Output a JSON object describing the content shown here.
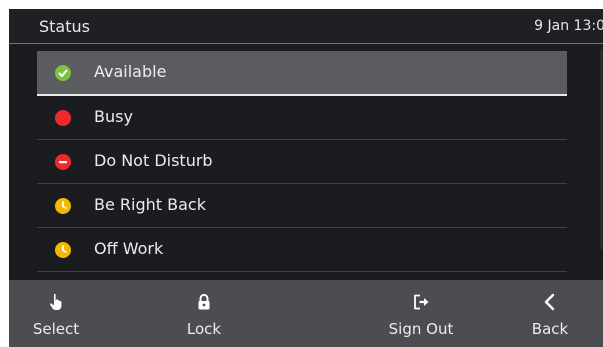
{
  "header": {
    "title": "Status",
    "time": "9 Jan 13:0"
  },
  "statuses": [
    {
      "label": "Available",
      "icon": "available-check-icon",
      "color": "#7cc242",
      "selected": true
    },
    {
      "label": "Busy",
      "icon": "busy-dot-icon",
      "color": "#f0282d",
      "selected": false
    },
    {
      "label": "Do Not Disturb",
      "icon": "do-not-disturb-icon",
      "color": "#f0282d",
      "selected": false
    },
    {
      "label": "Be Right Back",
      "icon": "clock-icon",
      "color": "#f5b800",
      "selected": false
    },
    {
      "label": "Off Work",
      "icon": "clock-icon",
      "color": "#f5b800",
      "selected": false
    }
  ],
  "softkeys": [
    {
      "label": "Select",
      "icon": "hand-pointer-icon"
    },
    {
      "label": "Lock",
      "icon": "lock-icon"
    },
    {
      "label": "Sign Out",
      "icon": "sign-out-icon"
    },
    {
      "label": "Back",
      "icon": "chevron-left-icon"
    }
  ],
  "colors": {
    "background": "#1b1c20",
    "accent_line": "#2d8fb0",
    "selected_row": "#5a5c60",
    "softkey_bar": "#4b4d51"
  }
}
